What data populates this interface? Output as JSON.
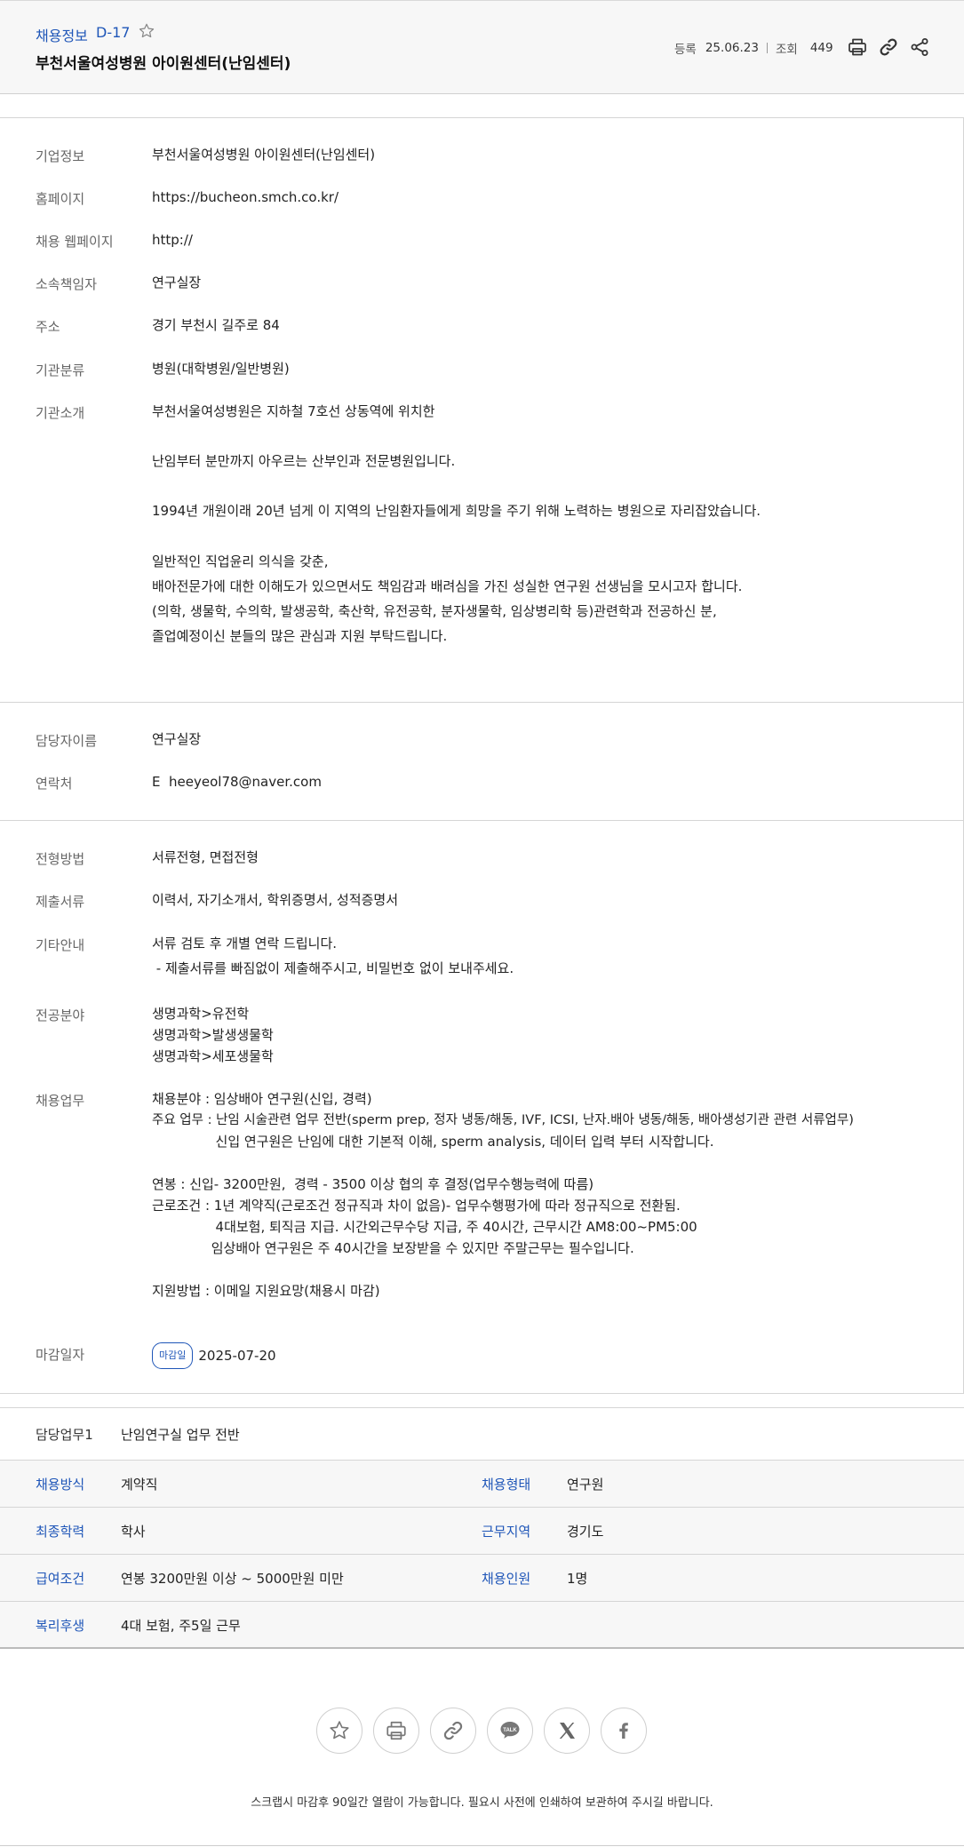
{
  "header": {
    "category": "채용정보",
    "dday": "D-17",
    "title": "부천서울여성병원 아이원센터(난임센터)",
    "reg_label": "등록",
    "reg_date": "25.06.23",
    "view_label": "조회",
    "view_count": "449",
    "icons": [
      "star-icon",
      "print-icon",
      "link-icon",
      "share-icon"
    ]
  },
  "company": {
    "rows": [
      {
        "label": "기업정보",
        "value": "부천서울여성병원 아이원센터(난임센터)"
      },
      {
        "label": "홈페이지",
        "value": "https://bucheon.smch.co.kr/"
      },
      {
        "label": "채용 웹페이지",
        "value": "http://"
      },
      {
        "label": "소속책임자",
        "value": "연구실장"
      },
      {
        "label": "주소",
        "value": "경기 부천시 길주로 84"
      },
      {
        "label": "기관분류",
        "value": "병원(대학병원/일반병원)"
      }
    ],
    "intro_label": "기관소개",
    "intro_lines": [
      "부천서울여성병원은  지하철 7호선 상동역에 위치한",
      "난임부터 분만까지 아우르는 산부인과 전문병원입니다.",
      "1994년 개원이래 20년 넘게 이 지역의 난임환자들에게 희망을 주기 위해 노력하는 병원으로 자리잡았습니다.",
      "일반적인 직업윤리 의식을 갖춘,",
      "배아전문가에 대한 이해도가 있으면서도 책임감과 배려심을 가진 성실한 연구원 선생님을 모시고자 합니다.",
      "(의학, 생물학, 수의학, 발생공학, 축산학, 유전공학, 분자생물학, 임상병리학 등)관련학과 전공하신 분,",
      "졸업예정이신 분들의 많은 관심과 지원 부탁드립니다."
    ]
  },
  "contact": {
    "name_label": "담당자이름",
    "name_value": "연구실장",
    "phone_label": "연락처",
    "email_prefix": "E",
    "email": "heeyeol78@naver.com"
  },
  "recruit": {
    "method_label": "전형방법",
    "method_value": "서류전형, 면접전형",
    "docs_label": "제출서류",
    "docs_value": "이력서, 자기소개서, 학위증명서, 성적증명서",
    "etc_label": "기타안내",
    "etc_lines": [
      "서류 검토 후 개별 연락 드립니다.",
      " - 제출서류를 빠짐없이 제출해주시고, 비밀번호 없이 보내주세요."
    ],
    "major_label": "전공분야",
    "major_lines": [
      "생명과학>유전학",
      "생명과학>발생생물학",
      "생명과학>세포생물학"
    ],
    "duty_label": "채용업무",
    "duty_lines": [
      "채용분야 : 임상배아 연구원(신입, 경력)",
      "주요 업무 : 난임 시술관련 업무 전반(sperm prep, 정자 냉동/해동, IVF, ICSI, 난자.배아 냉동/해동, 배아생성기관 관련 서류업무)",
      "               신입 연구원은 난임에 대한 기본적 이해, sperm analysis, 데이터 입력 부터 시작합니다.",
      "",
      "연봉 : 신입- 3200만원,  경력 - 3500 이상 협의 후 결정(업무수행능력에 따름)",
      "근로조건 : 1년 계약직(근로조건 정규직과 차이 없음)- 업무수행평가에 따라 정규직으로 전환됨.",
      "               4대보험, 퇴직금 지급. 시간외근무수당 지급, 주 40시간, 근무시간 AM8:00~PM5:00",
      "              임상배아 연구원은 주 40시간을 보장받을 수 있지만 주말근무는 필수입니다.",
      "",
      "지원방법 : 이메일 지원요망(채용시 마감)"
    ],
    "deadline_label": "마감일자",
    "deadline_badge": "마감일",
    "deadline_value": "2025-07-20"
  },
  "summary": {
    "duty1_label": "담당업무1",
    "duty1_value": "난임연구실 업무 전반",
    "rows": [
      {
        "l1": "채용방식",
        "v1": "계약직",
        "l2": "채용형태",
        "v2": "연구원"
      },
      {
        "l1": "최종학력",
        "v1": "학사",
        "l2": "근무지역",
        "v2": "경기도"
      },
      {
        "l1": "급여조건",
        "v1": "연봉 3200만원 이상 ~ 5000만원 미만",
        "l2": "채용인원",
        "v2": "1명"
      },
      {
        "l1": "복리후생",
        "v1": "4대 보험, 주5일 근무",
        "l2": "",
        "v2": ""
      }
    ]
  },
  "footer": {
    "share_icons": [
      "star-icon",
      "print-icon",
      "link-icon",
      "kakaotalk-icon",
      "x-icon",
      "facebook-icon"
    ],
    "kakao_text": "TALK",
    "note": "스크랩시 마감후 90일간 열람이 가능합니다. 필요시 사전에 인쇄하여 보관하여 주시길 바랍니다."
  },
  "colors": {
    "accent": "#1f56b8",
    "header_bg": "#f7f7f7",
    "border": "#d5d5d5"
  }
}
